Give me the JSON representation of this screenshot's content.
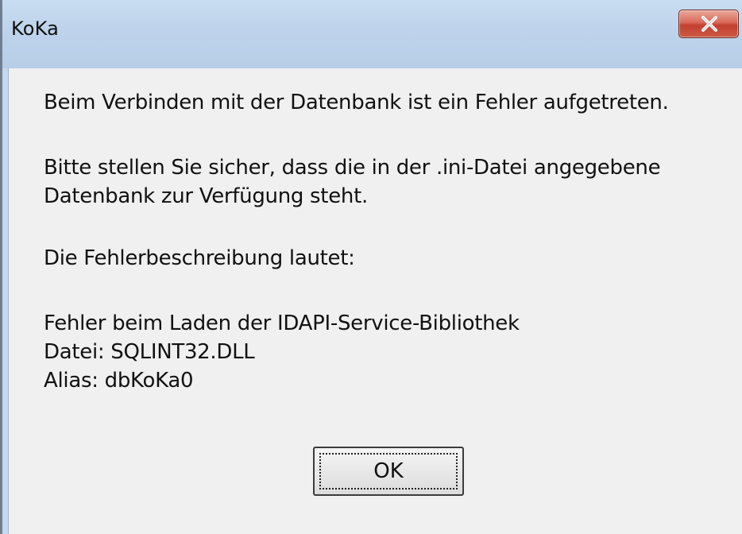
{
  "window": {
    "title": "KoKa",
    "close_icon": "close-x-icon"
  },
  "message": {
    "line1": "Beim Verbinden mit der Datenbank ist ein Fehler aufgetreten.",
    "line2": "Bitte stellen Sie sicher, dass die in der .ini-Datei angegebene",
    "line3": "Datenbank zur Verfügung steht.",
    "line4": "Die Fehlerbeschreibung lautet:",
    "line5": "Fehler beim Laden der IDAPI-Service-Bibliothek",
    "line6": "Datei: SQLINT32.DLL",
    "line7": "Alias: dbKoKa0"
  },
  "buttons": {
    "ok_label": "OK"
  },
  "colors": {
    "titlebar": "#bed3eb",
    "client_bg": "#f0f0f0",
    "close_button": "#c3402f"
  }
}
